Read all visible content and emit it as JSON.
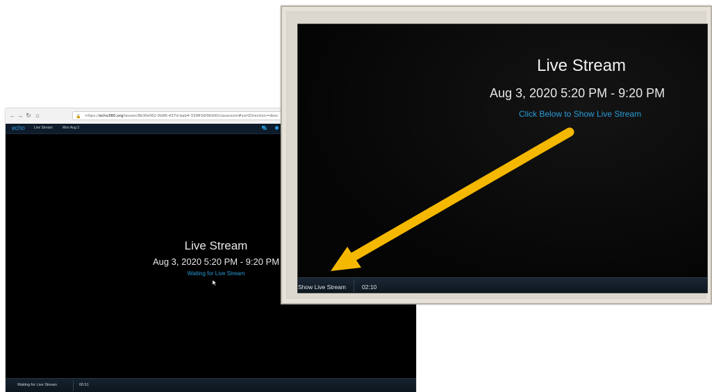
{
  "browser": {
    "url_host": "echo360.org",
    "url_rest": "/lesson/8b3fe062-0b86-437d-bab4-33983df0bfd0/classroom#sortDirection=desc",
    "url_prefix": "https://",
    "app": {
      "logo": "echo",
      "nav_label": "Live Stream",
      "date_label": "Mon Aug 3"
    },
    "player": {
      "title": "Live Stream",
      "date_range": "Aug 3, 2020 5:20 PM - 9:20 PM",
      "status": "Waiting for Live Stream",
      "control_label": "Waiting for Live Stream",
      "elapsed": "00:51"
    }
  },
  "zoom": {
    "title": "Live Stream",
    "date_range": "Aug 3, 2020 5:20 PM - 9:20 PM",
    "link_text": "Click Below to Show Live Stream",
    "control_label": "Show Live Stream",
    "elapsed": "02:10"
  },
  "colors": {
    "accent_blue": "#2a9bd6",
    "arrow": "#f5b800",
    "player_bg": "#000000",
    "frame": "#dcd8cf"
  }
}
